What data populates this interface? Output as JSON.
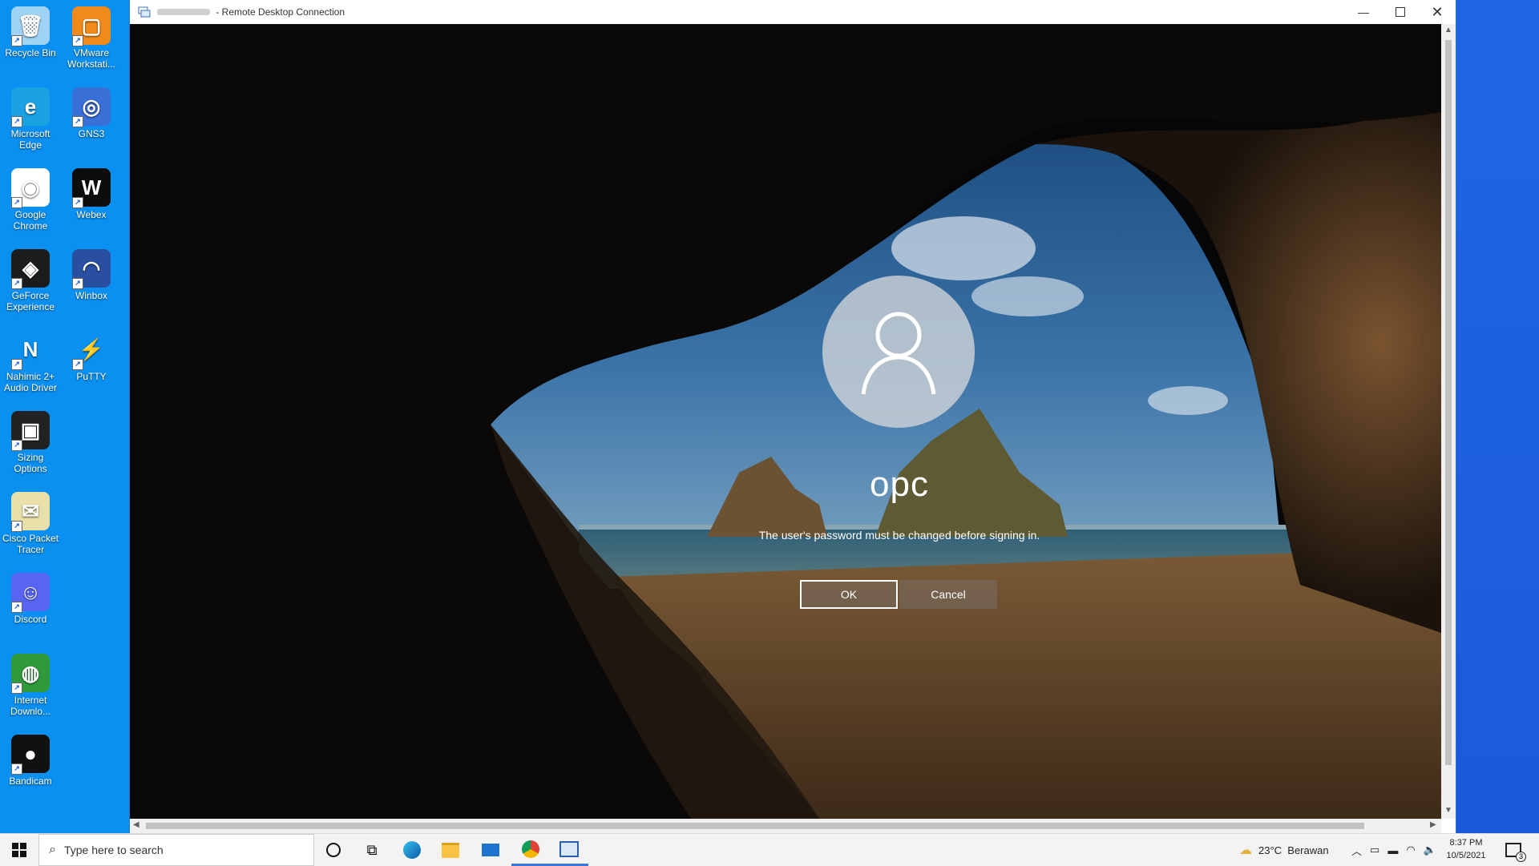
{
  "desktop": {
    "icons_col1": [
      {
        "name": "recycle-bin-icon",
        "label": "Recycle Bin",
        "color": "#9fd3f5",
        "glyph": "🗑"
      },
      {
        "name": "edge-desktop-icon",
        "label": "Microsoft Edge",
        "color": "#1aa1e2",
        "glyph": "e"
      },
      {
        "name": "chrome-desktop-icon",
        "label": "Google Chrome",
        "color": "#ffffff",
        "glyph": "◉"
      },
      {
        "name": "geforce-desktop-icon",
        "label": "GeForce Experience",
        "color": "#1c1c1c",
        "glyph": "◈"
      },
      {
        "name": "nahimic-desktop-icon",
        "label": "Nahimic 2+ Audio Driver",
        "color": "#0a90f0",
        "glyph": "N"
      },
      {
        "name": "sizing-options-desktop-icon",
        "label": "Sizing Options",
        "color": "#222222",
        "glyph": "▣"
      },
      {
        "name": "cisco-packet-tracer-desktop-icon",
        "label": "Cisco Packet Tracer",
        "color": "#e8e0a8",
        "glyph": "✉"
      },
      {
        "name": "discord-desktop-icon",
        "label": "Discord",
        "color": "#5865f2",
        "glyph": "☺"
      },
      {
        "name": "internet-download-manager-desktop-icon",
        "label": "Internet Downlo...",
        "color": "#2f9a3a",
        "glyph": "◍"
      },
      {
        "name": "bandicam-desktop-icon",
        "label": "Bandicam",
        "color": "#111111",
        "glyph": "●"
      }
    ],
    "icons_col2": [
      {
        "name": "vmware-desktop-icon",
        "label": "VMware Workstati...",
        "color": "#f08a1a",
        "glyph": "▢"
      },
      {
        "name": "gns3-desktop-icon",
        "label": "GNS3",
        "color": "#3a6fd8",
        "glyph": "◎"
      },
      {
        "name": "webex-desktop-icon",
        "label": "Webex",
        "color": "#0d0d0d",
        "glyph": "W"
      },
      {
        "name": "winbox-desktop-icon",
        "label": "Winbox",
        "color": "#2a4fa0",
        "glyph": "◠"
      },
      {
        "name": "putty-desktop-icon",
        "label": "PuTTY",
        "color": "#0a90f0",
        "glyph": "⚡"
      }
    ]
  },
  "window": {
    "title": "Remote Desktop Connection",
    "title_prefix": " - "
  },
  "login": {
    "username": "opc",
    "message": "The user's password must be changed before signing in.",
    "ok_label": "OK",
    "cancel_label": "Cancel"
  },
  "taskbar": {
    "search_placeholder": "Type here to search",
    "weather": "23°C  Berawan",
    "time": "8:37 PM",
    "date": "10/5/2021",
    "notification_count": "3"
  },
  "colors": {
    "desktop_blue": "#0a90f0",
    "taskbar_bg": "#f3f3f3",
    "accent": "#3b78d6"
  }
}
